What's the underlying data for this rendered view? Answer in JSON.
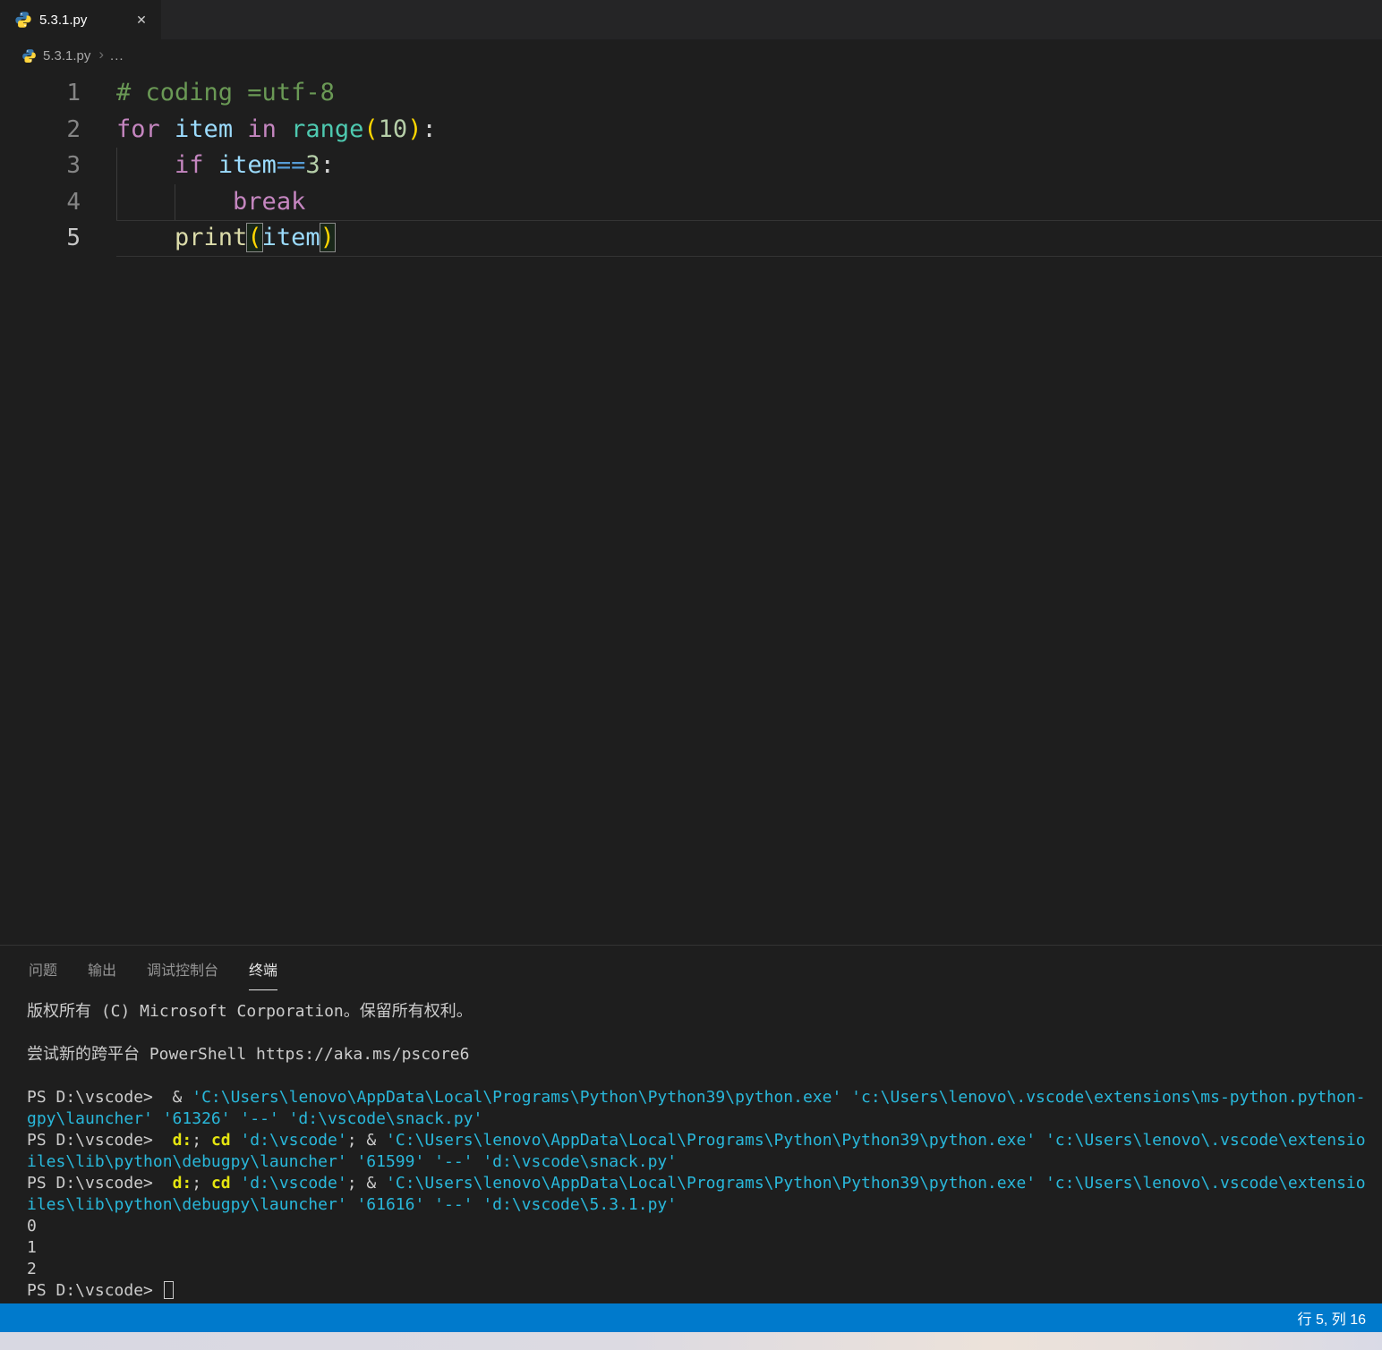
{
  "tab": {
    "title": "5.3.1.py",
    "close_glyph": "✕"
  },
  "breadcrumb": {
    "file": "5.3.1.py",
    "separator": "›",
    "ellipsis": "..."
  },
  "editor": {
    "active_line": 5,
    "lines": [
      {
        "num": "1",
        "tokens": [
          {
            "t": "# coding =utf-8",
            "c": "comment"
          }
        ]
      },
      {
        "num": "2",
        "tokens": [
          {
            "t": "for",
            "c": "kw"
          },
          {
            "t": " ",
            "c": "plain"
          },
          {
            "t": "item",
            "c": "var"
          },
          {
            "t": " ",
            "c": "plain"
          },
          {
            "t": "in",
            "c": "kw"
          },
          {
            "t": " ",
            "c": "plain"
          },
          {
            "t": "range",
            "c": "builtin"
          },
          {
            "t": "(",
            "c": "br"
          },
          {
            "t": "10",
            "c": "num"
          },
          {
            "t": ")",
            "c": "br"
          },
          {
            "t": ":",
            "c": "op"
          }
        ]
      },
      {
        "num": "3",
        "tokens": [
          {
            "t": "    ",
            "c": "plain"
          },
          {
            "t": "if",
            "c": "kw"
          },
          {
            "t": " ",
            "c": "plain"
          },
          {
            "t": "item",
            "c": "var"
          },
          {
            "t": "==",
            "c": "opb"
          },
          {
            "t": "3",
            "c": "num"
          },
          {
            "t": ":",
            "c": "op"
          }
        ]
      },
      {
        "num": "4",
        "tokens": [
          {
            "t": "        ",
            "c": "plain"
          },
          {
            "t": "break",
            "c": "kw"
          }
        ]
      },
      {
        "num": "5",
        "tokens": [
          {
            "t": "    ",
            "c": "plain"
          },
          {
            "t": "print",
            "c": "func"
          },
          {
            "t": "(",
            "c": "br",
            "m": true
          },
          {
            "t": "item",
            "c": "var"
          },
          {
            "t": ")",
            "c": "br",
            "m": true
          }
        ]
      }
    ]
  },
  "panel": {
    "tabs": [
      {
        "id": "problems",
        "label": "问题",
        "active": false
      },
      {
        "id": "output",
        "label": "输出",
        "active": false
      },
      {
        "id": "debug-console",
        "label": "调试控制台",
        "active": false
      },
      {
        "id": "terminal",
        "label": "终端",
        "active": true
      }
    ]
  },
  "terminal": {
    "lines": [
      {
        "segments": [
          {
            "t": "版权所有 (C) Microsoft Corporation。保留所有权利。",
            "c": "fg"
          }
        ]
      },
      {
        "segments": []
      },
      {
        "segments": [
          {
            "t": "尝试新的跨平台 PowerShell https://aka.ms/pscore6",
            "c": "fg"
          }
        ]
      },
      {
        "segments": []
      },
      {
        "segments": [
          {
            "t": "PS D:\\vscode>  & ",
            "c": "fg"
          },
          {
            "t": "'C:\\Users\\lenovo\\AppData\\Local\\Programs\\Python\\Python39\\python.exe'",
            "c": "cyan"
          },
          {
            "t": " ",
            "c": "fg"
          },
          {
            "t": "'c:\\Users\\lenovo\\.vscode\\extensions\\ms-python.python-",
            "c": "cyan"
          }
        ]
      },
      {
        "segments": [
          {
            "t": "gpy\\launcher' '61326' '--' 'd:\\vscode\\snack.py'",
            "c": "cyan"
          }
        ]
      },
      {
        "segments": [
          {
            "t": "PS D:\\vscode>  ",
            "c": "fg"
          },
          {
            "t": "d:",
            "c": "yellow"
          },
          {
            "t": "; ",
            "c": "fg"
          },
          {
            "t": "cd",
            "c": "yellow"
          },
          {
            "t": " ",
            "c": "fg"
          },
          {
            "t": "'d:\\vscode'",
            "c": "cyan"
          },
          {
            "t": "; & ",
            "c": "fg"
          },
          {
            "t": "'C:\\Users\\lenovo\\AppData\\Local\\Programs\\Python\\Python39\\python.exe'",
            "c": "cyan"
          },
          {
            "t": " ",
            "c": "fg"
          },
          {
            "t": "'c:\\Users\\lenovo\\.vscode\\extensio",
            "c": "cyan"
          }
        ]
      },
      {
        "segments": [
          {
            "t": "iles\\lib\\python\\debugpy\\launcher' '61599' '--' 'd:\\vscode\\snack.py'",
            "c": "cyan"
          }
        ]
      },
      {
        "segments": [
          {
            "t": "PS D:\\vscode>  ",
            "c": "fg"
          },
          {
            "t": "d:",
            "c": "yellow"
          },
          {
            "t": "; ",
            "c": "fg"
          },
          {
            "t": "cd",
            "c": "yellow"
          },
          {
            "t": " ",
            "c": "fg"
          },
          {
            "t": "'d:\\vscode'",
            "c": "cyan"
          },
          {
            "t": "; & ",
            "c": "fg"
          },
          {
            "t": "'C:\\Users\\lenovo\\AppData\\Local\\Programs\\Python\\Python39\\python.exe'",
            "c": "cyan"
          },
          {
            "t": " ",
            "c": "fg"
          },
          {
            "t": "'c:\\Users\\lenovo\\.vscode\\extensio",
            "c": "cyan"
          }
        ]
      },
      {
        "segments": [
          {
            "t": "iles\\lib\\python\\debugpy\\launcher' '61616' '--' 'd:\\vscode\\5.3.1.py'",
            "c": "cyan"
          }
        ]
      },
      {
        "segments": [
          {
            "t": "0",
            "c": "fg"
          }
        ]
      },
      {
        "segments": [
          {
            "t": "1",
            "c": "fg"
          }
        ]
      },
      {
        "segments": [
          {
            "t": "2",
            "c": "fg"
          }
        ]
      },
      {
        "segments": [
          {
            "t": "PS D:\\vscode> ",
            "c": "fg"
          }
        ],
        "cursor": true
      }
    ]
  },
  "status_bar": {
    "cursor_position": "行 5, 列 16"
  },
  "colors": {
    "status_bar_bg": "#007acc",
    "editor_bg": "#1e1e1e",
    "tab_strip_bg": "#252526",
    "terminal_string": "#29b8db",
    "terminal_command": "#e5e510",
    "comment": "#6a9955",
    "keyword": "#c586c0",
    "variable": "#9cdcfe",
    "builtin": "#4ec9b0",
    "function": "#dcdcaa",
    "number": "#b5cea8",
    "bracket": "#ffd700"
  }
}
